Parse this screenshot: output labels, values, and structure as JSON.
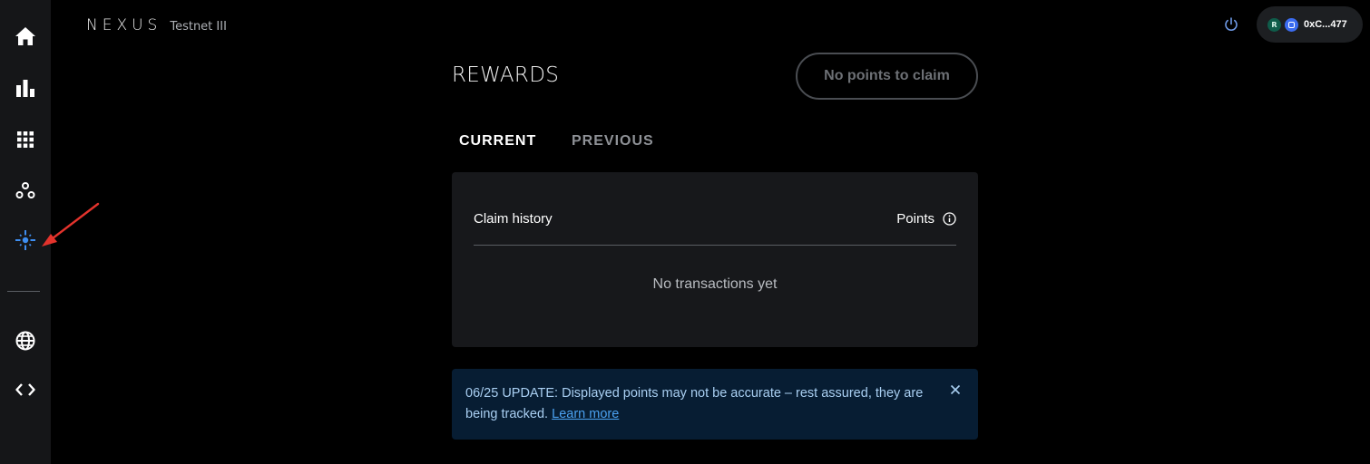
{
  "brand": {
    "logo": "NEXUS",
    "network": "Testnet III"
  },
  "sidebar": {
    "items": [
      {
        "icon": "home-icon"
      },
      {
        "icon": "bar-chart-icon"
      },
      {
        "icon": "grid-icon"
      },
      {
        "icon": "nodes-icon"
      },
      {
        "icon": "rewards-sparkle-icon",
        "active": true
      },
      {
        "icon": "globe-icon"
      },
      {
        "icon": "code-icon"
      }
    ]
  },
  "header": {
    "wallet": {
      "avatar_letter": "R",
      "address": "0xC...477"
    }
  },
  "rewards": {
    "title": "REWARDS",
    "claim_button": "No points to claim",
    "tabs": [
      {
        "label": "CURRENT",
        "active": true
      },
      {
        "label": "PREVIOUS",
        "active": false
      }
    ],
    "table": {
      "left_header": "Claim history",
      "right_header": "Points",
      "empty_text": "No transactions yet"
    }
  },
  "notice": {
    "text": "06/25 UPDATE: Displayed points may not be accurate – rest assured, they are being tracked.",
    "link": "Learn more"
  },
  "colors": {
    "background": "#000000",
    "sidebar": "#151618",
    "accent_active": "#3e8ef0",
    "notice_bg": "#071d33",
    "link": "#4ba1f0",
    "annotation_arrow": "#e3332c"
  }
}
